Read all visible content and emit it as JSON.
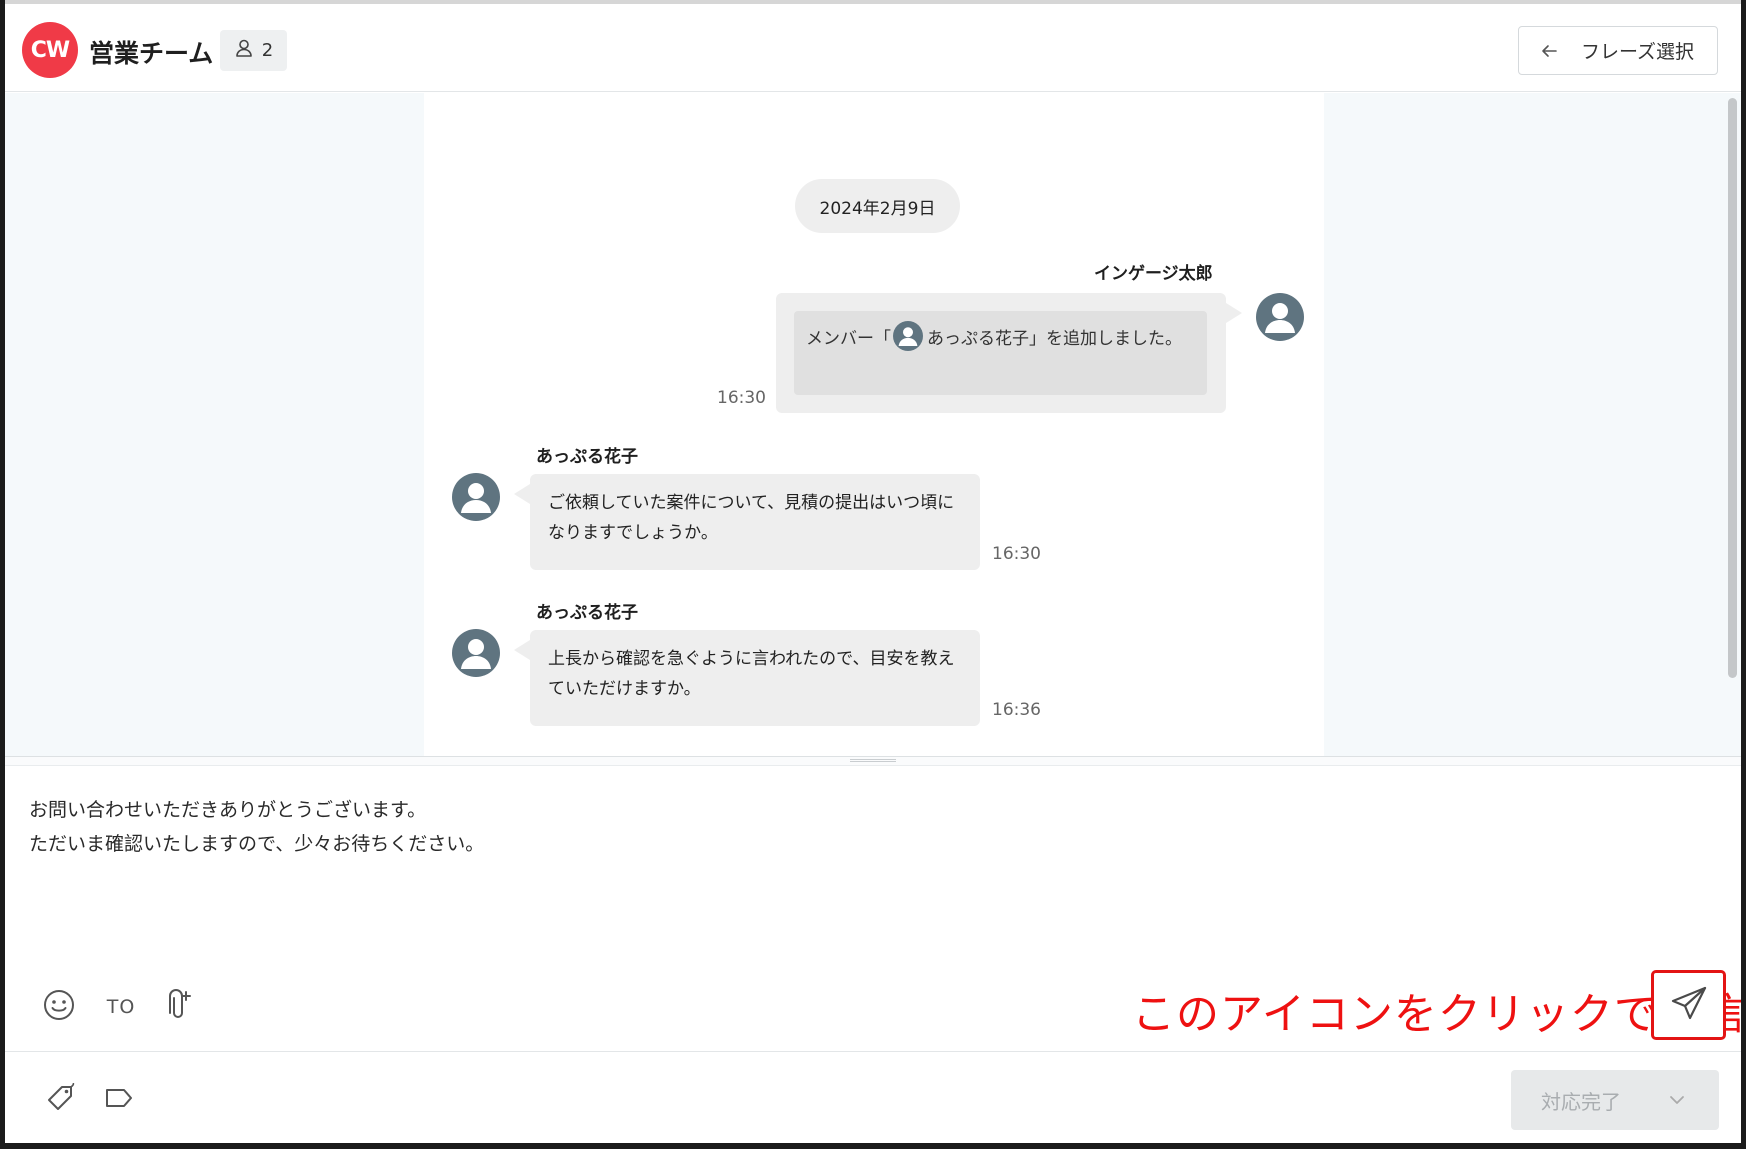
{
  "header": {
    "logo_text": "CW",
    "room_title": "営業チーム",
    "member_count": "2",
    "phrase_button_label": "フレーズ選択"
  },
  "timeline": {
    "date_label": "2024年2月9日",
    "messages": [
      {
        "sender": "インゲージ太郎",
        "text_before": "メンバー「",
        "mention_name": "あっぷる花子",
        "text_after": "」を追加しました。",
        "time": "16:30",
        "side": "right"
      },
      {
        "sender": "あっぷる花子",
        "text": "ご依頼していた案件について、見積の提出はいつ頃になりますでしょうか。",
        "time": "16:30",
        "side": "left"
      },
      {
        "sender": "あっぷる花子",
        "text": "上長から確認を急ぐように言われたので、目安を教えていただけますか。",
        "time": "16:36",
        "side": "left"
      }
    ]
  },
  "composer": {
    "draft_text": "お問い合わせいただきありがとうございます。\nただいま確認いたしますので、少々お待ちください。",
    "to_label": "TO",
    "send_hint": "このアイコンをクリックで送信"
  },
  "footer": {
    "done_button_label": "対応完了"
  },
  "colors": {
    "brand": "#f03a47",
    "avatar": "#5f7480",
    "annotation_red": "#e31414",
    "chat_background": "#f5f9fb"
  },
  "icons": [
    "member-icon",
    "arrow-left-icon",
    "smile-icon",
    "attachment-icon",
    "send-icon",
    "tag-icon",
    "label-icon",
    "chevron-down-icon"
  ]
}
